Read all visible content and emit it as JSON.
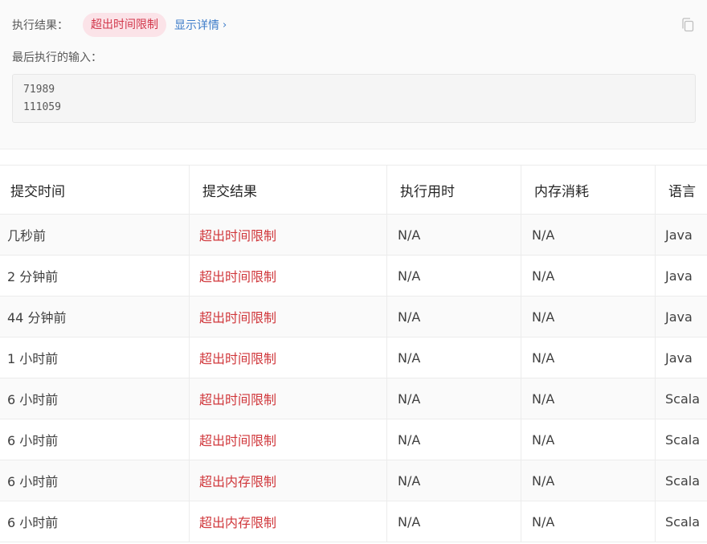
{
  "result": {
    "label": "执行结果：",
    "status": "超出时间限制",
    "status_color": "#d2374b",
    "details_link": "显示详情",
    "details_chevron": "›",
    "copy_icon": "copy-icon"
  },
  "last_input": {
    "label": "最后执行的输入：",
    "lines": [
      "71989",
      "111059"
    ]
  },
  "table": {
    "columns": [
      "提交时间",
      "提交结果",
      "执行用时",
      "内存消耗",
      "语言"
    ],
    "rows": [
      {
        "time": "几秒前",
        "result": "超出时间限制",
        "runtime": "N/A",
        "memory": "N/A",
        "lang": "Java"
      },
      {
        "time": "2 分钟前",
        "result": "超出时间限制",
        "runtime": "N/A",
        "memory": "N/A",
        "lang": "Java"
      },
      {
        "time": "44 分钟前",
        "result": "超出时间限制",
        "runtime": "N/A",
        "memory": "N/A",
        "lang": "Java"
      },
      {
        "time": "1 小时前",
        "result": "超出时间限制",
        "runtime": "N/A",
        "memory": "N/A",
        "lang": "Java"
      },
      {
        "time": "6 小时前",
        "result": "超出时间限制",
        "runtime": "N/A",
        "memory": "N/A",
        "lang": "Scala"
      },
      {
        "time": "6 小时前",
        "result": "超出时间限制",
        "runtime": "N/A",
        "memory": "N/A",
        "lang": "Scala"
      },
      {
        "time": "6 小时前",
        "result": "超出内存限制",
        "runtime": "N/A",
        "memory": "N/A",
        "lang": "Scala"
      },
      {
        "time": "6 小时前",
        "result": "超出内存限制",
        "runtime": "N/A",
        "memory": "N/A",
        "lang": "Scala"
      }
    ],
    "result_color": "#d0373b"
  }
}
